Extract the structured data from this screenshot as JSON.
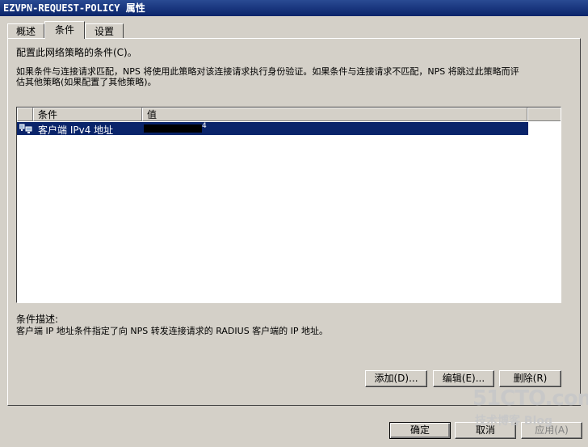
{
  "window": {
    "title": "EZVPN-REQUEST-POLICY 属性"
  },
  "tabs": [
    {
      "label": "概述"
    },
    {
      "label": "条件"
    },
    {
      "label": "设置"
    }
  ],
  "conditions": {
    "heading": "配置此网络策略的条件(C)。",
    "description_line1": "如果条件与连接请求匹配，NPS 将使用此策略对该连接请求执行身份验证。如果条件与连接请求不匹配，NPS 将跳过此策略而评",
    "description_line2": "估其他策略(如果配置了其他策略)。",
    "columns": {
      "condition": "条件",
      "value": "值"
    },
    "rows": [
      {
        "condition": "客户端 IPv4 地址",
        "value": "4",
        "icon": "network-computers-icon"
      }
    ],
    "desc_label": "条件描述:",
    "desc_text": "客户端 IP 地址条件指定了向 NPS 转发连接请求的 RADIUS 客户端的 IP 地址。"
  },
  "actions": {
    "add": "添加(D)...",
    "edit": "编辑(E)...",
    "delete": "删除(R)"
  },
  "footer": {
    "ok": "确定",
    "cancel": "取消",
    "apply": "应用(A)"
  },
  "watermark": {
    "brand": "51CTO.com",
    "tagline": "技术博客 Blog"
  }
}
